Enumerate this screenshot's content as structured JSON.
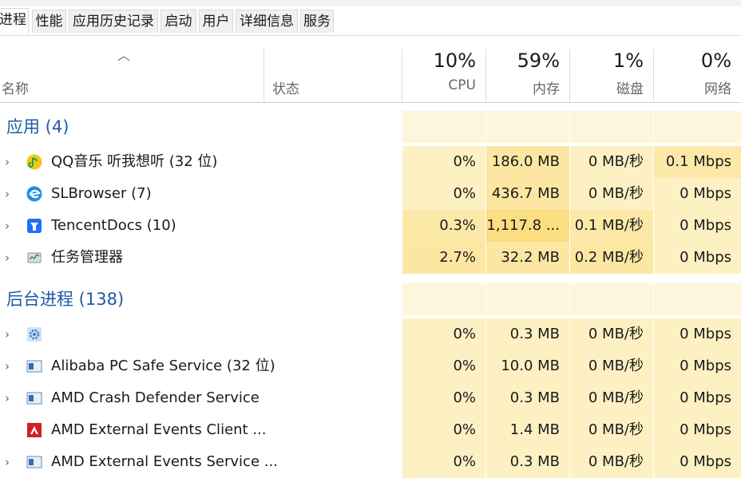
{
  "tabs": [
    {
      "label": "进程",
      "active": true
    },
    {
      "label": "性能"
    },
    {
      "label": "应用历史记录"
    },
    {
      "label": "启动"
    },
    {
      "label": "用户"
    },
    {
      "label": "详细信息"
    },
    {
      "label": "服务"
    }
  ],
  "header": {
    "name_label": "名称",
    "status_label": "状态",
    "cpu_pct": "10%",
    "cpu_label": "CPU",
    "mem_pct": "59%",
    "mem_label": "内存",
    "disk_pct": "1%",
    "disk_label": "磁盘",
    "net_pct": "0%",
    "net_label": "网络"
  },
  "groups": {
    "apps": "应用 (4)",
    "background": "后台进程 (138)"
  },
  "apps": [
    {
      "name": "QQ音乐 听我想听 (32 位)",
      "icon": "qqmusic-icon",
      "cpu": "0%",
      "mem": "186.0 MB",
      "disk": "0 MB/秒",
      "net": "0.1 Mbps"
    },
    {
      "name": "SLBrowser (7)",
      "icon": "slbrowser-icon",
      "cpu": "0%",
      "mem": "436.7 MB",
      "disk": "0 MB/秒",
      "net": "0 Mbps"
    },
    {
      "name": "TencentDocs (10)",
      "icon": "tencentdocs-icon",
      "cpu": "0.3%",
      "mem": "1,117.8 ...",
      "disk": "0.1 MB/秒",
      "net": "0 Mbps"
    },
    {
      "name": "任务管理器",
      "icon": "taskmanager-icon",
      "cpu": "2.7%",
      "mem": "32.2 MB",
      "disk": "0.2 MB/秒",
      "net": "0 Mbps"
    }
  ],
  "background": [
    {
      "name": "",
      "icon": "gear-icon",
      "cpu": "0%",
      "mem": "0.3 MB",
      "disk": "0 MB/秒",
      "net": "0 Mbps",
      "expand": true
    },
    {
      "name": "Alibaba PC Safe Service (32 位)",
      "icon": "service-icon",
      "cpu": "0%",
      "mem": "10.0 MB",
      "disk": "0 MB/秒",
      "net": "0 Mbps",
      "expand": true
    },
    {
      "name": "AMD Crash Defender Service",
      "icon": "service-icon",
      "cpu": "0%",
      "mem": "0.3 MB",
      "disk": "0 MB/秒",
      "net": "0 Mbps",
      "expand": true
    },
    {
      "name": "AMD External Events Client ...",
      "icon": "amd-icon",
      "cpu": "0%",
      "mem": "1.4 MB",
      "disk": "0 MB/秒",
      "net": "0 Mbps",
      "expand": false
    },
    {
      "name": "AMD External Events Service ...",
      "icon": "service-icon",
      "cpu": "0%",
      "mem": "0.3 MB",
      "disk": "0 MB/秒",
      "net": "0 Mbps",
      "expand": true
    }
  ],
  "colors": {
    "group_text": "#1f5aa6",
    "heat_light": "#fff4c4",
    "heat_mid": "#ffe9a6",
    "heat_strong": "#fde08a"
  }
}
